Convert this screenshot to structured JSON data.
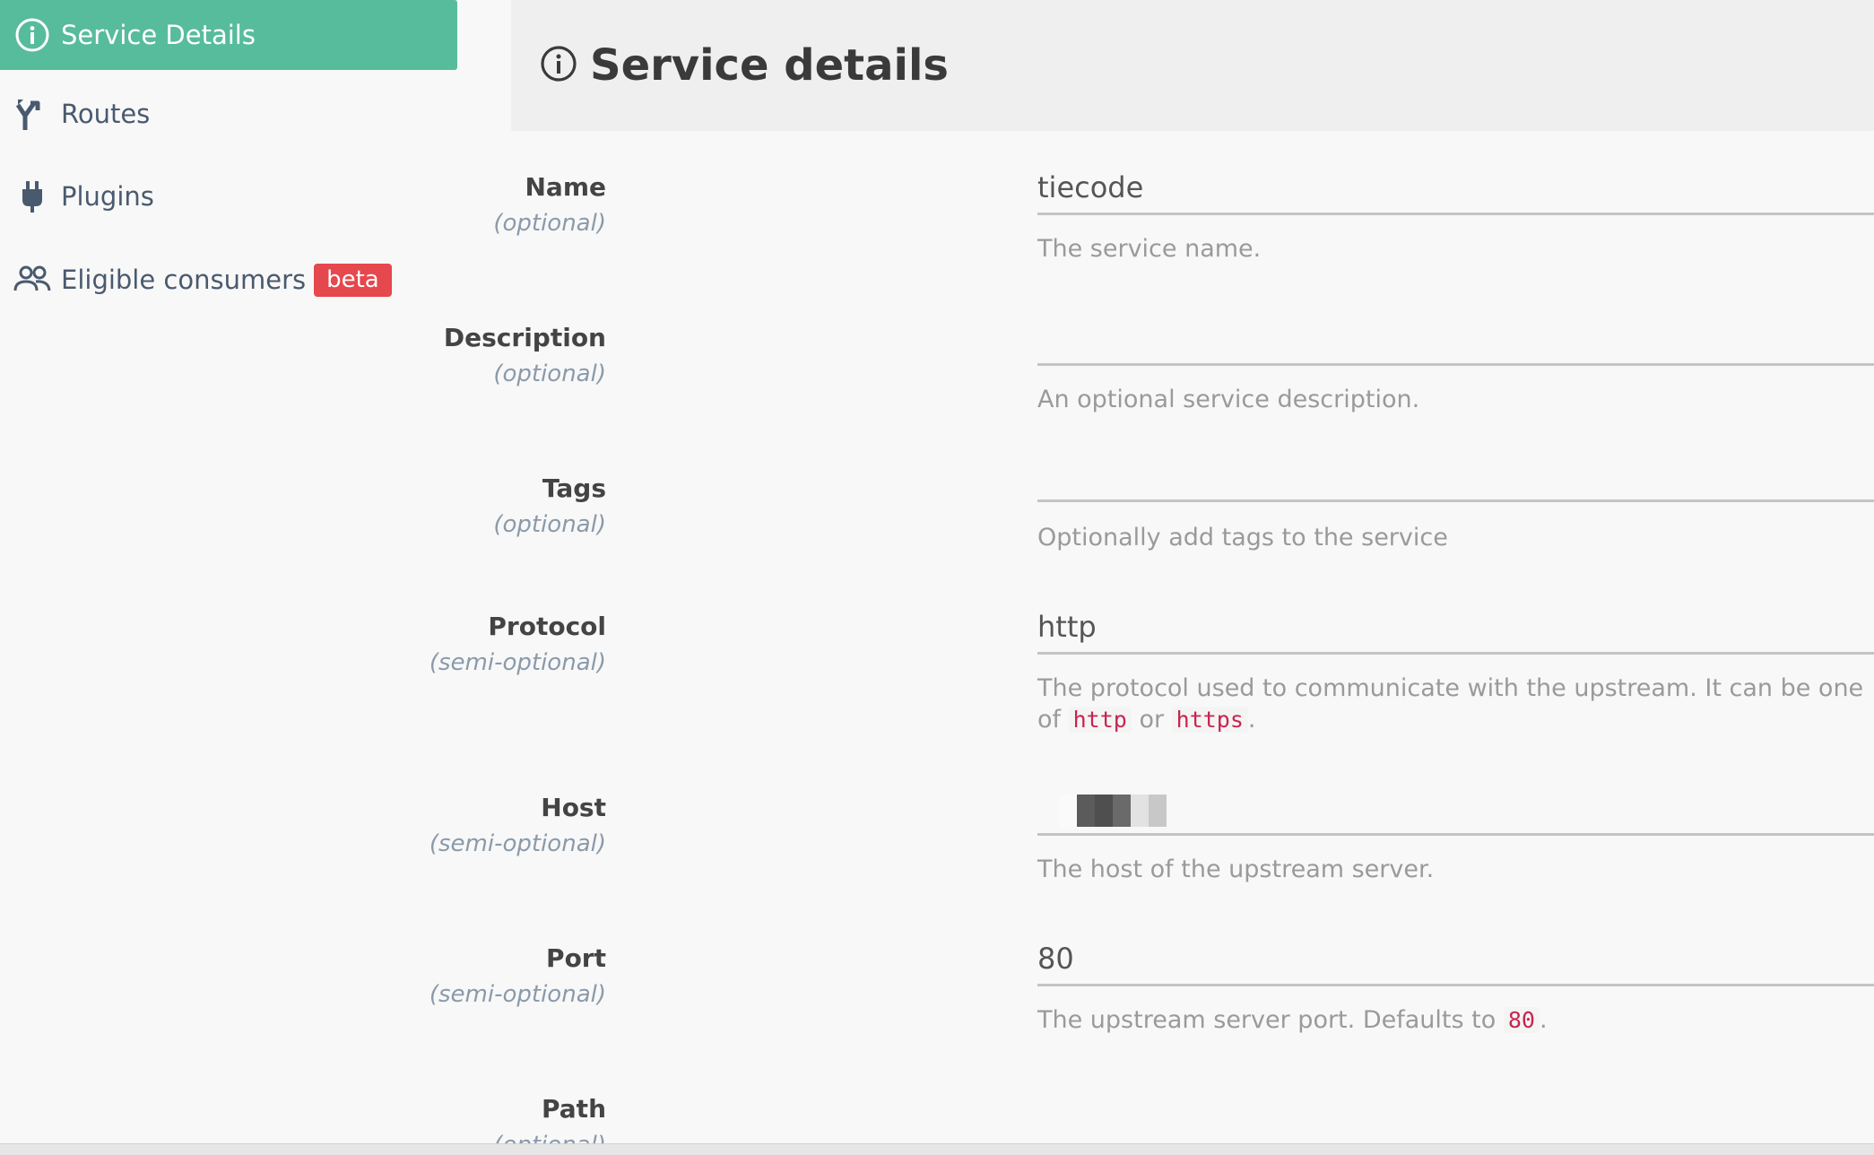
{
  "sidebar": {
    "items": [
      {
        "label": "Service Details",
        "icon": "info-circle-icon"
      },
      {
        "label": "Routes",
        "icon": "route-fork-icon"
      },
      {
        "label": "Plugins",
        "icon": "plug-icon"
      },
      {
        "label": "Eligible consumers",
        "icon": "users-icon",
        "badge": "beta"
      }
    ]
  },
  "header": {
    "title": "Service details",
    "icon": "info-circle-icon"
  },
  "colors": {
    "accent": "#57bc9c",
    "badge": "#e5484d",
    "code": "#c7254e"
  },
  "form": {
    "name": {
      "label": "Name",
      "qualifier": "(optional)",
      "value": "tiecode",
      "help": "The service name."
    },
    "description": {
      "label": "Description",
      "qualifier": "(optional)",
      "value": "",
      "help": "An optional service description."
    },
    "tags": {
      "label": "Tags",
      "qualifier": "(optional)",
      "value": "",
      "help": "Optionally add tags to the service"
    },
    "protocol": {
      "label": "Protocol",
      "qualifier": "(semi-optional)",
      "value": "http",
      "help_prefix": "The protocol used to communicate with the upstream. It can be one of",
      "help_code1": "http",
      "help_or": "or",
      "help_code2": "https",
      "help_suffix": "."
    },
    "host": {
      "label": "Host",
      "qualifier": "(semi-optional)",
      "value": "",
      "help": "The host of the upstream server."
    },
    "port": {
      "label": "Port",
      "qualifier": "(semi-optional)",
      "value": "80",
      "help_prefix": "The upstream server port. Defaults to",
      "help_code": "80",
      "help_suffix": "."
    },
    "path": {
      "label": "Path",
      "qualifier": "(optional)"
    }
  }
}
